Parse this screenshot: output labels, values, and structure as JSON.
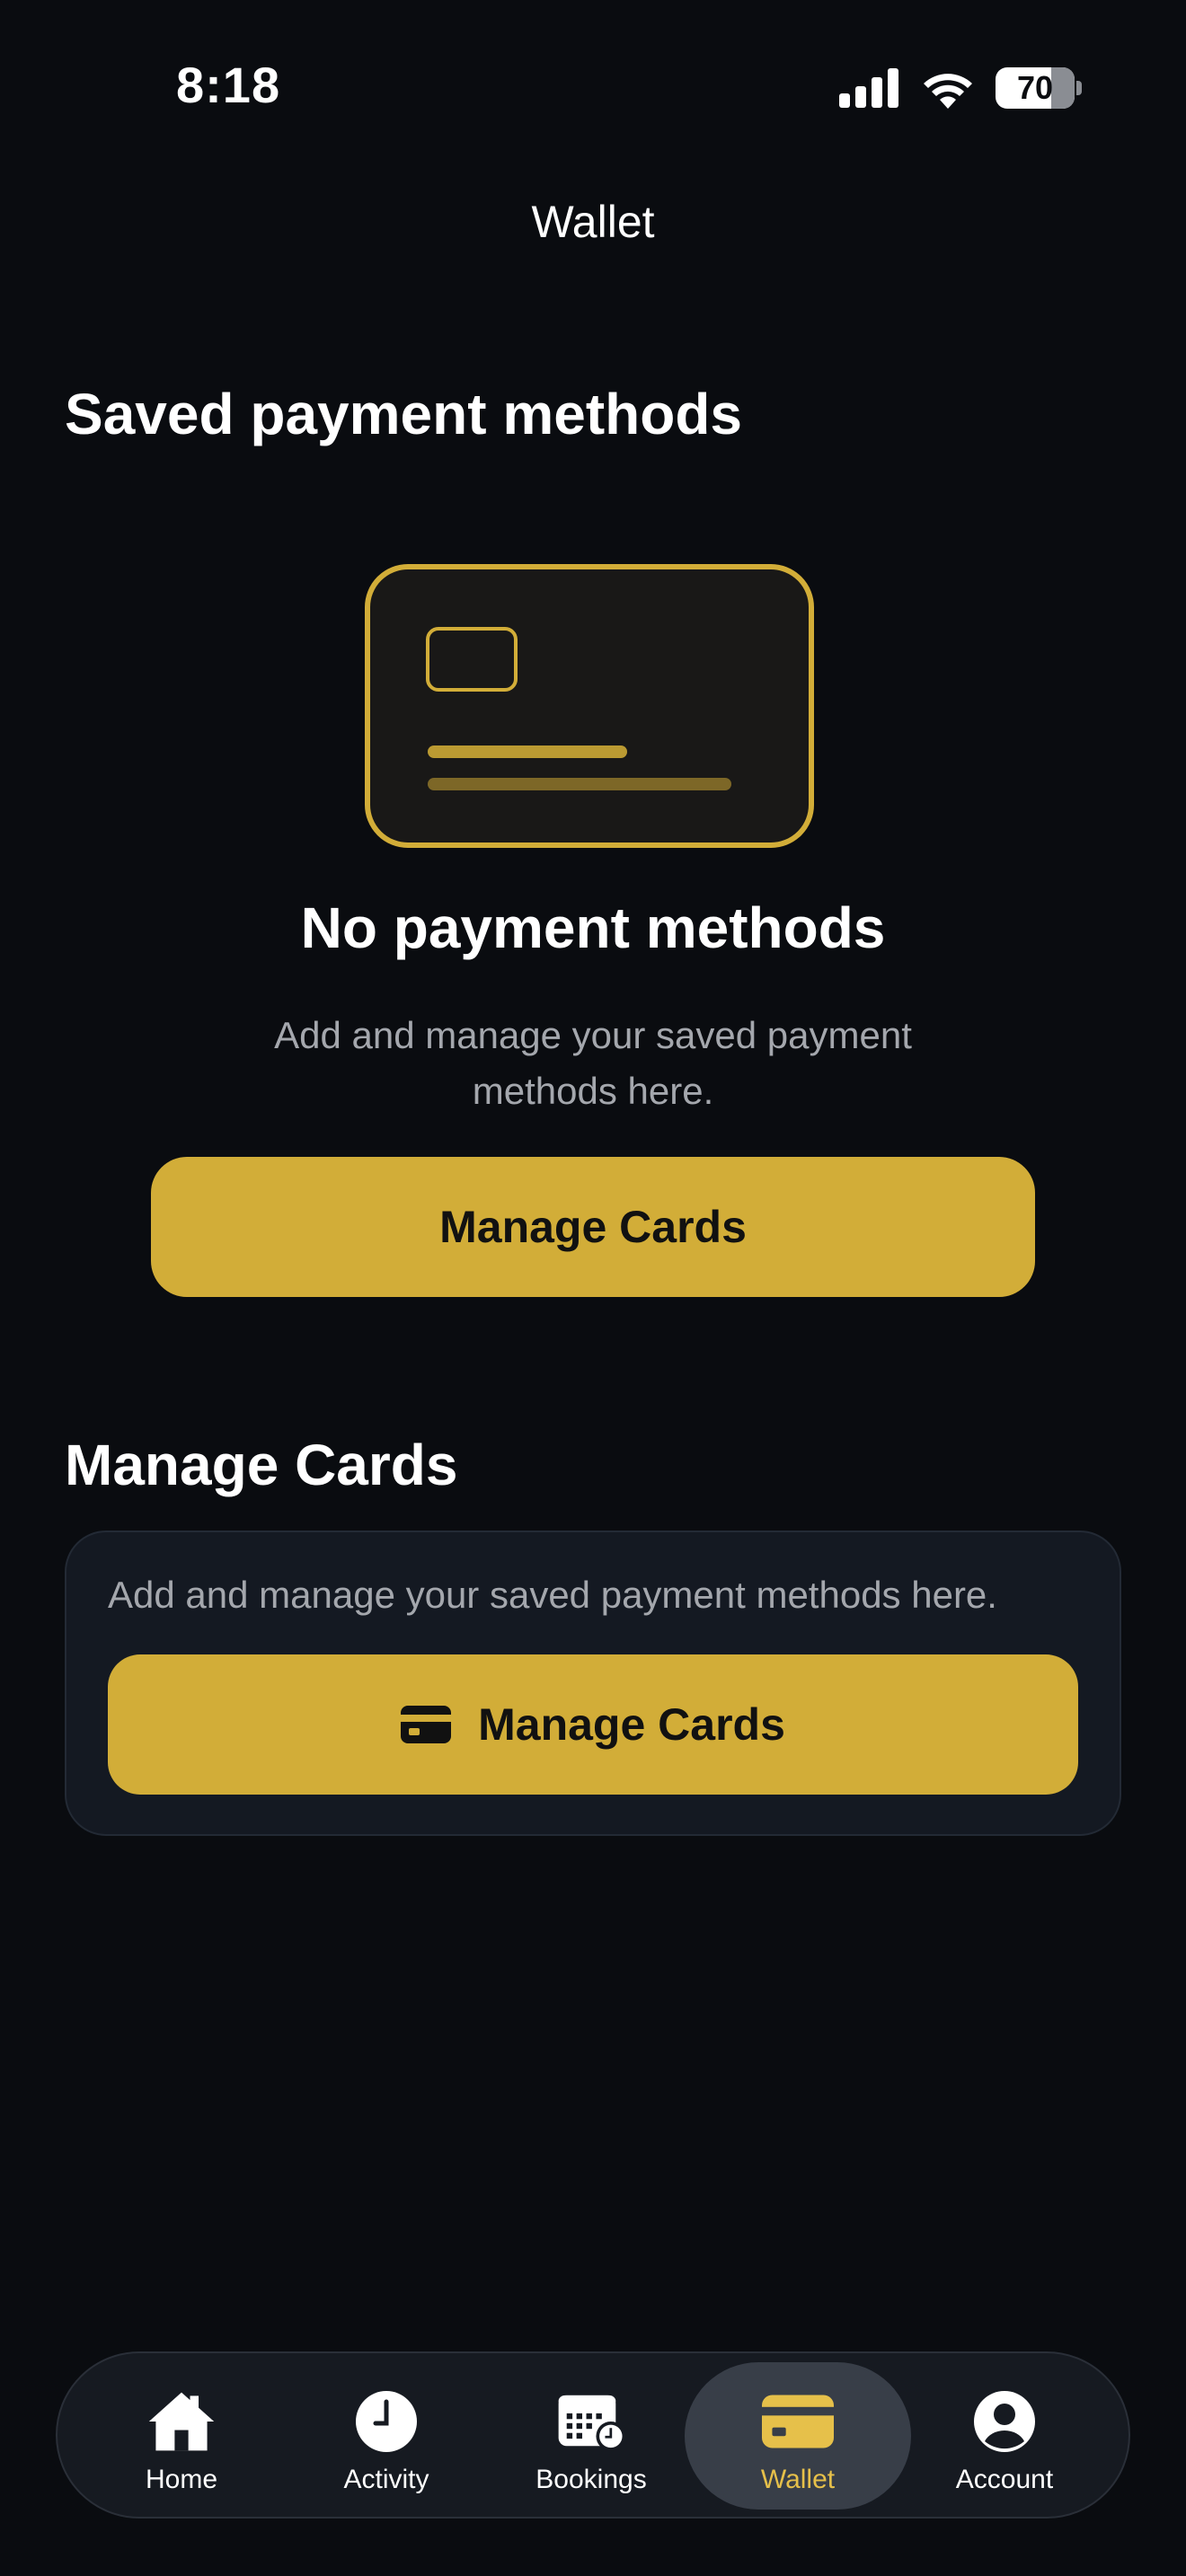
{
  "status_bar": {
    "time": "8:18",
    "battery": "70"
  },
  "header": {
    "title": "Wallet"
  },
  "saved_section": {
    "title": "Saved payment methods",
    "empty_title": "No payment methods",
    "empty_description": "Add and manage your saved payment methods here.",
    "button_label": "Manage Cards"
  },
  "manage_section": {
    "title": "Manage Cards",
    "description": "Add and manage your saved payment methods here.",
    "button_label": "Manage Cards"
  },
  "tabs": [
    {
      "label": "Home",
      "icon": "home-icon",
      "active": false
    },
    {
      "label": "Activity",
      "icon": "clock-icon",
      "active": false
    },
    {
      "label": "Bookings",
      "icon": "calendar-icon",
      "active": false
    },
    {
      "label": "Wallet",
      "icon": "wallet-card-icon",
      "active": true
    },
    {
      "label": "Account",
      "icon": "account-icon",
      "active": false
    }
  ],
  "colors": {
    "background": "#0a0c10",
    "accent": "#d2ad38",
    "panel": "#141922",
    "muted_text": "#a4a7ad"
  }
}
